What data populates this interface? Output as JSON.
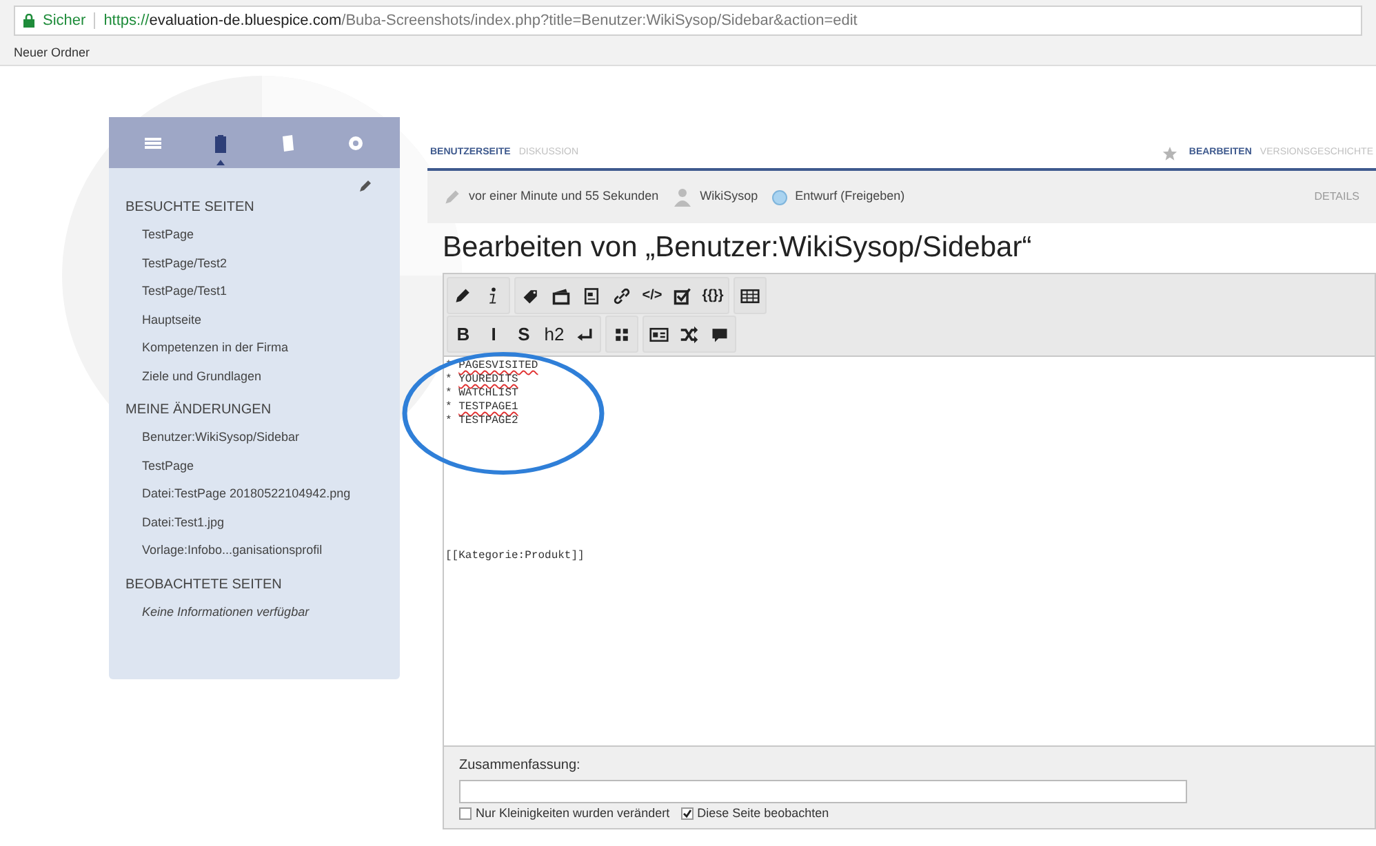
{
  "browser": {
    "secure_label": "Sicher",
    "url_scheme": "https://",
    "url_host": "evaluation-de.bluespice.com",
    "url_path": "/Buba-Screenshots/index.php?title=Benutzer:WikiSysop/Sidebar&action=edit",
    "bookmarks": [
      "Neuer Ordner"
    ]
  },
  "sidebar": {
    "tabs": [
      {
        "selected": false
      },
      {
        "selected": true
      },
      {
        "selected": false
      },
      {
        "selected": false
      }
    ],
    "sections": [
      {
        "title": "BESUCHTE SEITEN",
        "items": [
          {
            "label": "TestPage",
            "kind": "link"
          },
          {
            "label": "TestPage/Test2",
            "kind": "link"
          },
          {
            "label": "TestPage/Test1",
            "kind": "link"
          },
          {
            "label": "Hauptseite",
            "kind": "link"
          },
          {
            "label": "Kompetenzen in der Firma",
            "kind": "link"
          },
          {
            "label": "Ziele und Grundlagen",
            "kind": "link"
          }
        ]
      },
      {
        "title": "MEINE ÄNDERUNGEN",
        "items": [
          {
            "label": "Benutzer:WikiSysop/Sidebar",
            "kind": "link"
          },
          {
            "label": "TestPage",
            "kind": "link"
          },
          {
            "label": "Datei:TestPage 20180522104942.png",
            "kind": "link"
          },
          {
            "label": "Datei:Test1.jpg",
            "kind": "link"
          },
          {
            "label": "Vorlage:Infobo...ganisationsprofil",
            "kind": "link"
          }
        ]
      },
      {
        "title": "BEOBACHTETE SEITEN",
        "items": [
          {
            "label": "Keine Informationen verfügbar",
            "kind": "note"
          }
        ]
      }
    ]
  },
  "page_tabs": {
    "left": [
      {
        "label": "BENUTZERSEITE",
        "selected": true
      },
      {
        "label": "DISKUSSION",
        "selected": false
      }
    ],
    "right": [
      {
        "label": "BEARBEITEN",
        "selected": true
      },
      {
        "label": "VERSIONSGESCHICHTE",
        "selected": false
      }
    ]
  },
  "meta": {
    "edited": "vor einer Minute und 55 Sekunden",
    "user": "WikiSysop",
    "status": "Entwurf (Freigeben)",
    "details": "DETAILS"
  },
  "heading": "Bearbeiten von „Benutzer:WikiSysop/Sidebar“",
  "toolbar": [
    [
      [
        {
          "kind": "icon"
        },
        {
          "kind": "icon"
        }
      ],
      [
        {
          "kind": "icon"
        },
        {
          "kind": "icon"
        },
        {
          "kind": "icon"
        },
        {
          "kind": "icon"
        },
        {
          "kind": "text",
          "label": "</>"
        },
        {
          "kind": "icon"
        },
        {
          "kind": "text",
          "label": "{{}}"
        }
      ],
      [
        {
          "kind": "icon"
        }
      ]
    ],
    [
      [
        {
          "kind": "text",
          "label": "B"
        },
        {
          "kind": "text",
          "label": "I"
        },
        {
          "kind": "text",
          "label": "S"
        },
        {
          "kind": "text",
          "label": "h2"
        },
        {
          "kind": "icon"
        }
      ],
      [
        {
          "kind": "icon"
        }
      ],
      [
        {
          "kind": "icon"
        },
        {
          "kind": "icon"
        },
        {
          "kind": "icon"
        }
      ]
    ]
  ],
  "editor_lines": [
    {
      "bullet": "*",
      "word": "PAGESVISITED",
      "misspelled": true
    },
    {
      "bullet": "*",
      "word": "YOUREDITS",
      "misspelled": true
    },
    {
      "bullet": "*",
      "word": "WATCHLIST",
      "misspelled": false
    },
    {
      "bullet": "*",
      "word": "TESTPAGE1",
      "misspelled": true
    },
    {
      "bullet": "*",
      "word": "TESTPAGE2",
      "misspelled": false
    }
  ],
  "editor_footer_line": "[[Kategorie:Produkt]]",
  "summary": {
    "label": "Zusammenfassung:"
  },
  "options": [
    {
      "label": "Nur Kleinigkeiten wurden verändert",
      "checked": false
    },
    {
      "label": "Diese Seite beobachten",
      "checked": true
    }
  ]
}
